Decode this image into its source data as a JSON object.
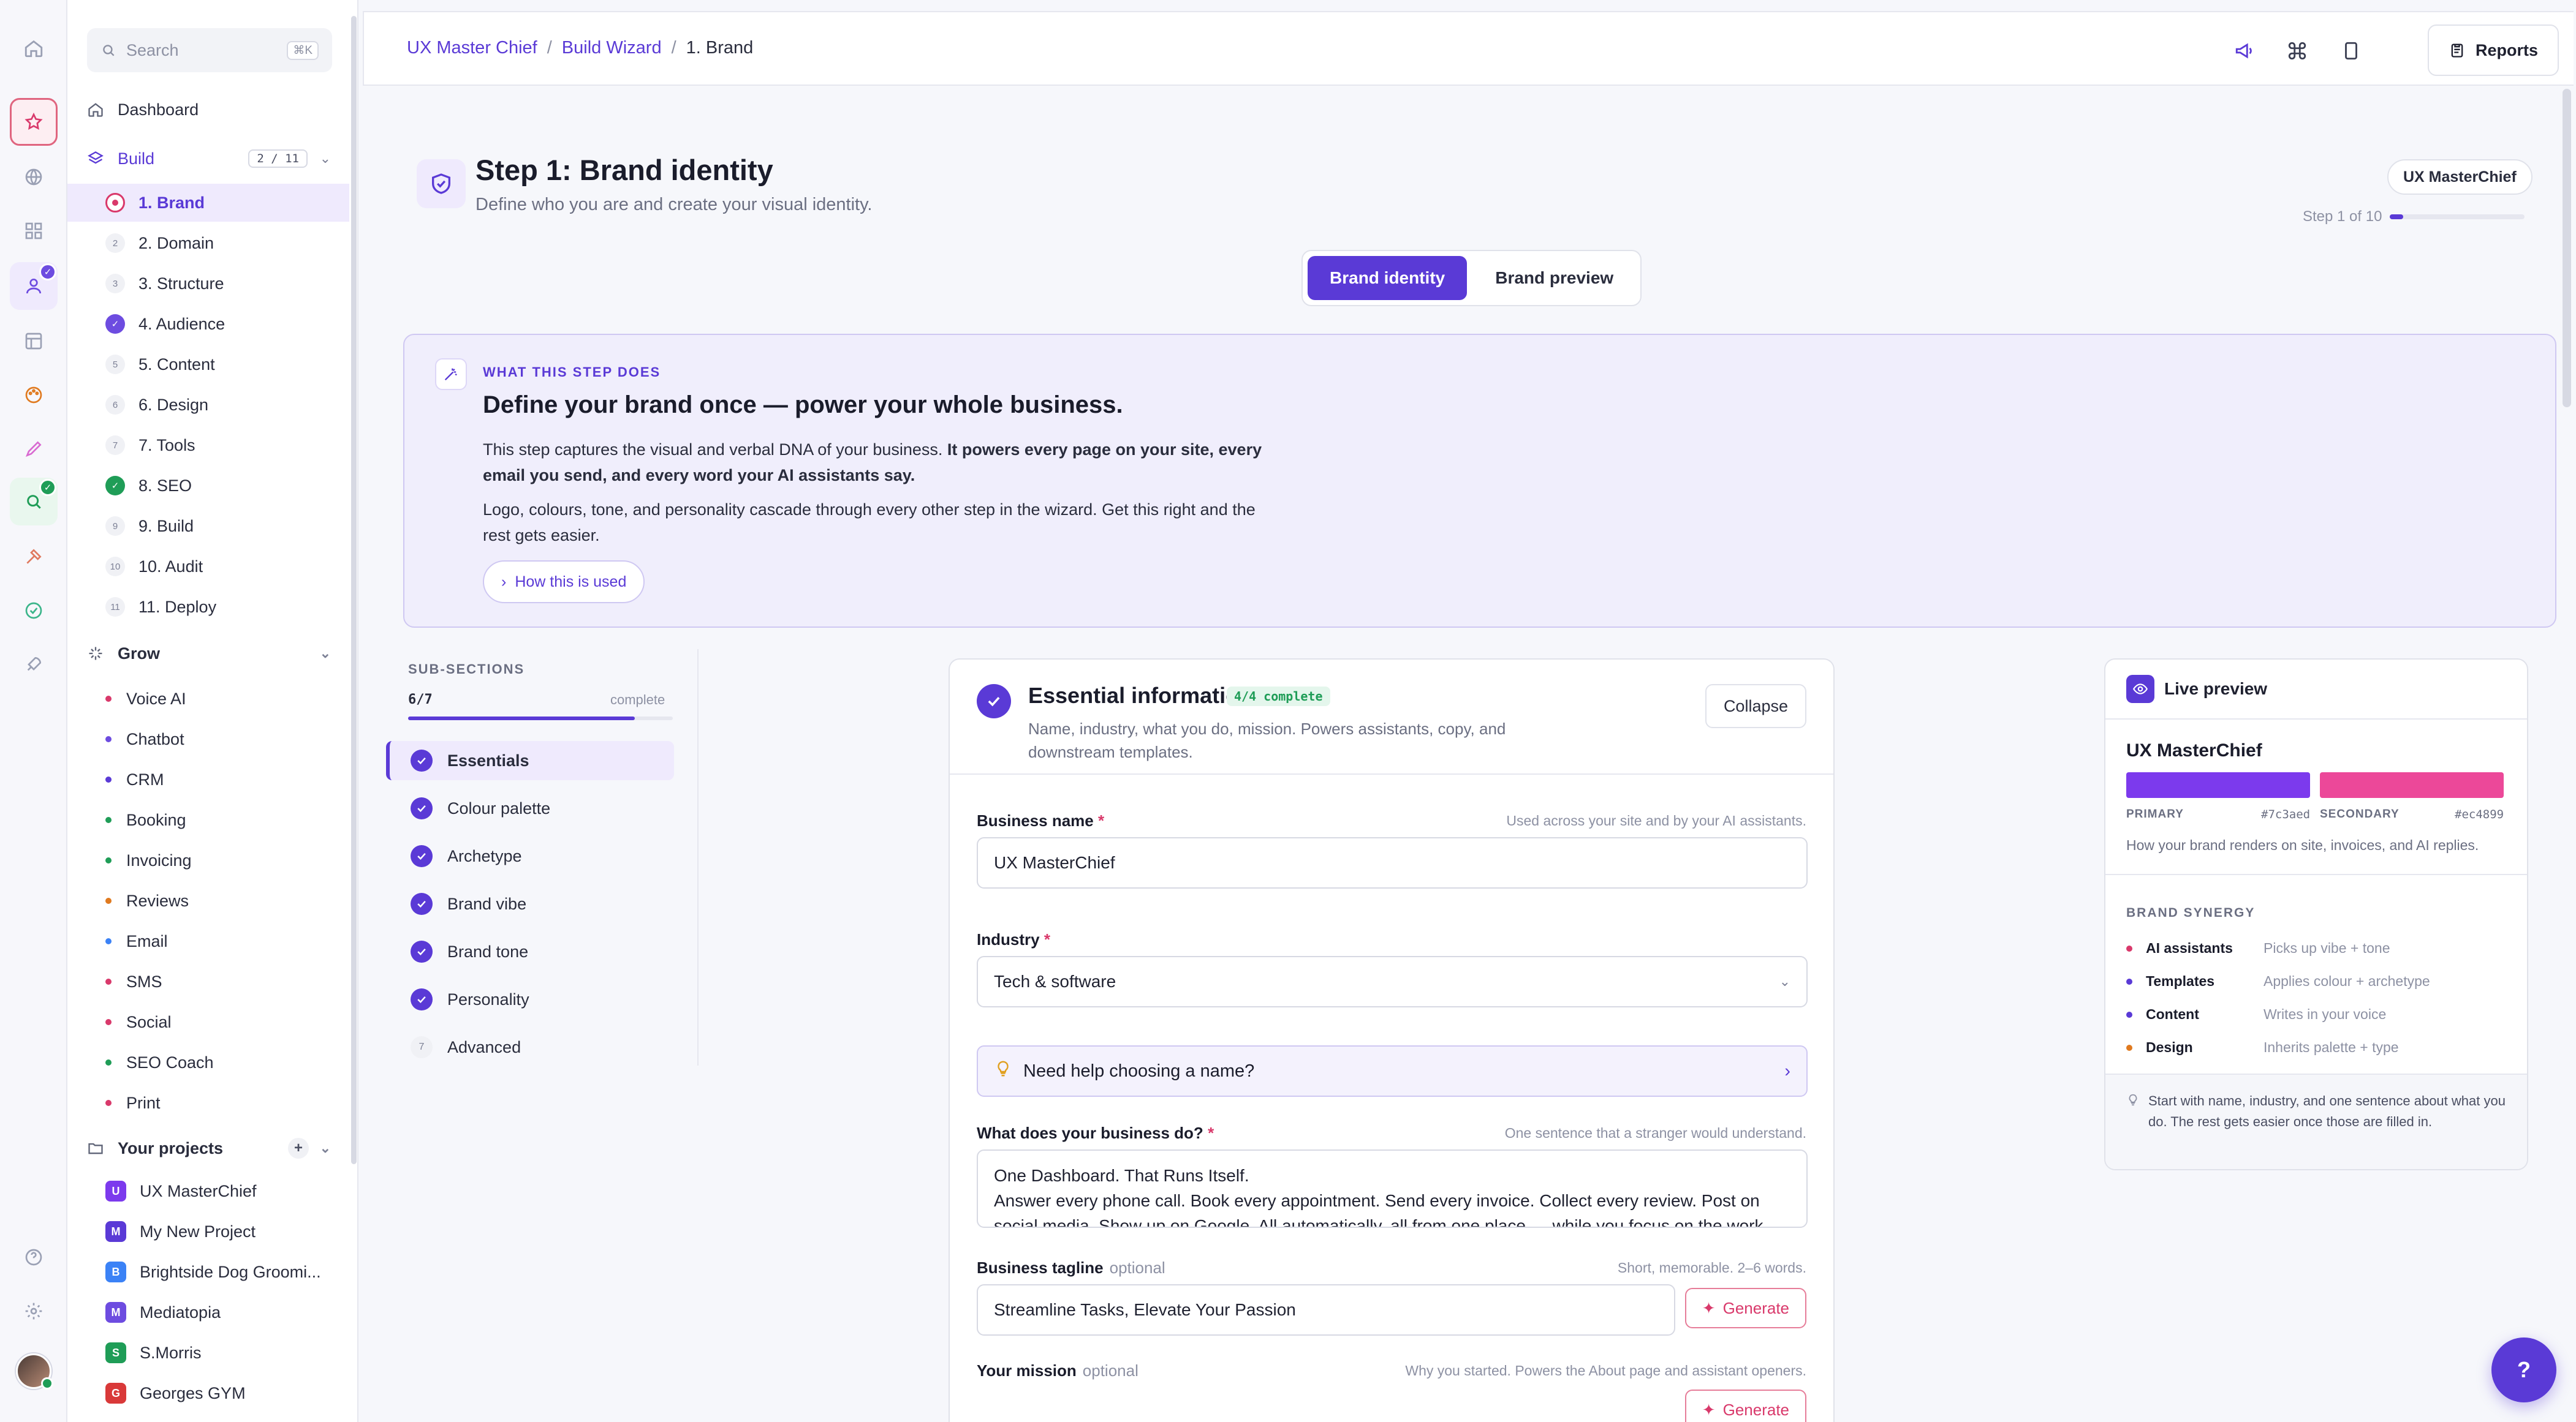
{
  "colors": {
    "accent": "#5a3ad6",
    "brand_primary": "#7c3aed",
    "brand_secondary": "#ec4899",
    "success": "#1f9d57",
    "danger": "#d9396b"
  },
  "sidebar": {
    "search_placeholder": "Search",
    "search_shortcut": "⌘K",
    "dashboard": "Dashboard",
    "build": {
      "label": "Build",
      "count": "2 / 11"
    },
    "steps": [
      {
        "num": "",
        "label": "1. Brand",
        "state": "current"
      },
      {
        "num": "2",
        "label": "2. Domain",
        "state": "todo"
      },
      {
        "num": "3",
        "label": "3. Structure",
        "state": "todo"
      },
      {
        "num": "✓",
        "label": "4. Audience",
        "state": "done"
      },
      {
        "num": "5",
        "label": "5. Content",
        "state": "todo"
      },
      {
        "num": "6",
        "label": "6. Design",
        "state": "todo"
      },
      {
        "num": "7",
        "label": "7. Tools",
        "state": "todo"
      },
      {
        "num": "✓",
        "label": "8. SEO",
        "state": "done-green"
      },
      {
        "num": "9",
        "label": "9. Build",
        "state": "todo"
      },
      {
        "num": "10",
        "label": "10. Audit",
        "state": "todo"
      },
      {
        "num": "11",
        "label": "11. Deploy",
        "state": "todo"
      }
    ],
    "grow": {
      "label": "Grow",
      "items": [
        {
          "label": "Voice AI",
          "color": "#d9396b"
        },
        {
          "label": "Chatbot",
          "color": "#6d4ce0"
        },
        {
          "label": "CRM",
          "color": "#5a3ad6"
        },
        {
          "label": "Booking",
          "color": "#1f9d57"
        },
        {
          "label": "Invoicing",
          "color": "#1f9d57"
        },
        {
          "label": "Reviews",
          "color": "#e07a1f"
        },
        {
          "label": "Email",
          "color": "#3b82f6"
        },
        {
          "label": "SMS",
          "color": "#d9396b"
        },
        {
          "label": "Social",
          "color": "#d9396b"
        },
        {
          "label": "SEO Coach",
          "color": "#1f9d57"
        },
        {
          "label": "Print",
          "color": "#d9396b"
        }
      ]
    },
    "projects": {
      "label": "Your projects",
      "items": [
        {
          "initial": "U",
          "label": "UX MasterChief",
          "color": "#7c3aed"
        },
        {
          "initial": "M",
          "label": "My New Project",
          "color": "#5a3ad6"
        },
        {
          "initial": "B",
          "label": "Brightside Dog Groomi...",
          "color": "#3b82f6"
        },
        {
          "initial": "M",
          "label": "Mediatopia",
          "color": "#6d4ce0"
        },
        {
          "initial": "S",
          "label": "S.Morris",
          "color": "#1f9d57"
        },
        {
          "initial": "G",
          "label": "Georges GYM",
          "color": "#d93939"
        }
      ]
    }
  },
  "header": {
    "breadcrumbs": [
      "UX Master Chief",
      "Build Wizard",
      "1. Brand"
    ],
    "separator": "/",
    "reports": "Reports"
  },
  "step": {
    "title": "Step 1: Brand identity",
    "subtitle": "Define who you are and create your visual identity.",
    "brand_pill": "UX MasterChief",
    "progress_label": "Step 1 of 10",
    "progress": 0.1,
    "tabs": [
      "Brand identity",
      "Brand preview"
    ]
  },
  "explainer": {
    "kicker": "WHAT THIS STEP DOES",
    "title": "Define your brand once — power your whole business.",
    "p1_a": "This step captures the visual and verbal DNA of your business. ",
    "p1_b": "It powers every page on your site, every email you send, and every word your AI assistants say.",
    "p2": "Logo, colours, tone, and personality cascade through every other step in the wizard. Get this right and the rest gets easier.",
    "button": "How this is used"
  },
  "subsections": {
    "label": "SUB-SECTIONS",
    "count": "6/7",
    "complete": "complete",
    "progress": 0.857,
    "items": [
      {
        "label": "Essentials",
        "done": true
      },
      {
        "label": "Colour palette",
        "done": true
      },
      {
        "label": "Archetype",
        "done": true
      },
      {
        "label": "Brand vibe",
        "done": true
      },
      {
        "label": "Brand tone",
        "done": true
      },
      {
        "label": "Personality",
        "done": true
      },
      {
        "label": "Advanced",
        "done": false,
        "num": "7"
      }
    ]
  },
  "form": {
    "title": "Essential information",
    "badge": "4/4 complete",
    "description": "Name, industry, what you do, mission. Powers assistants, copy, and downstream templates.",
    "collapse": "Collapse",
    "business_name": {
      "label": "Business name",
      "hint": "Used across your site and by your AI assistants.",
      "value": "UX MasterChief"
    },
    "industry": {
      "label": "Industry",
      "value": "Tech & software"
    },
    "help": "Need help choosing a name?",
    "what": {
      "label": "What does your business do?",
      "hint": "One sentence that a stranger would understand.",
      "line1": "One Dashboard. That Runs Itself.",
      "line2": "Answer every phone call. Book every appointment. Send every invoice. Collect every review. Post on",
      "line3": "social media. Show up on Google. All automatically, all from one place — while you focus on the work"
    },
    "tagline": {
      "label": "Business tagline",
      "optional": "optional",
      "hint": "Short, memorable. 2–6 words.",
      "value": "Streamline Tasks, Elevate Your Passion",
      "generate": "Generate"
    },
    "mission": {
      "label": "Your mission",
      "optional": "optional",
      "hint": "Why you started. Powers the About page and assistant openers.",
      "generate": "Generate"
    }
  },
  "preview": {
    "title": "Live preview",
    "brand": "UX MasterChief",
    "primary_label": "PRIMARY",
    "primary_hex": "#7c3aed",
    "secondary_label": "SECONDARY",
    "secondary_hex": "#ec4899",
    "note": "How your brand renders on site, invoices, and AI replies.",
    "synergy_title": "BRAND SYNERGY",
    "synergy": [
      {
        "name": "AI assistants",
        "desc": "Picks up vibe + tone",
        "color": "#d9396b"
      },
      {
        "name": "Templates",
        "desc": "Applies colour + archetype",
        "color": "#5a3ad6"
      },
      {
        "name": "Content",
        "desc": "Writes in your voice",
        "color": "#5a3ad6"
      },
      {
        "name": "Design",
        "desc": "Inherits palette + type",
        "color": "#e07a1f"
      }
    ],
    "tip": "Start with name, industry, and one sentence about what you do. The rest gets easier once those are filled in."
  },
  "fab": "?"
}
